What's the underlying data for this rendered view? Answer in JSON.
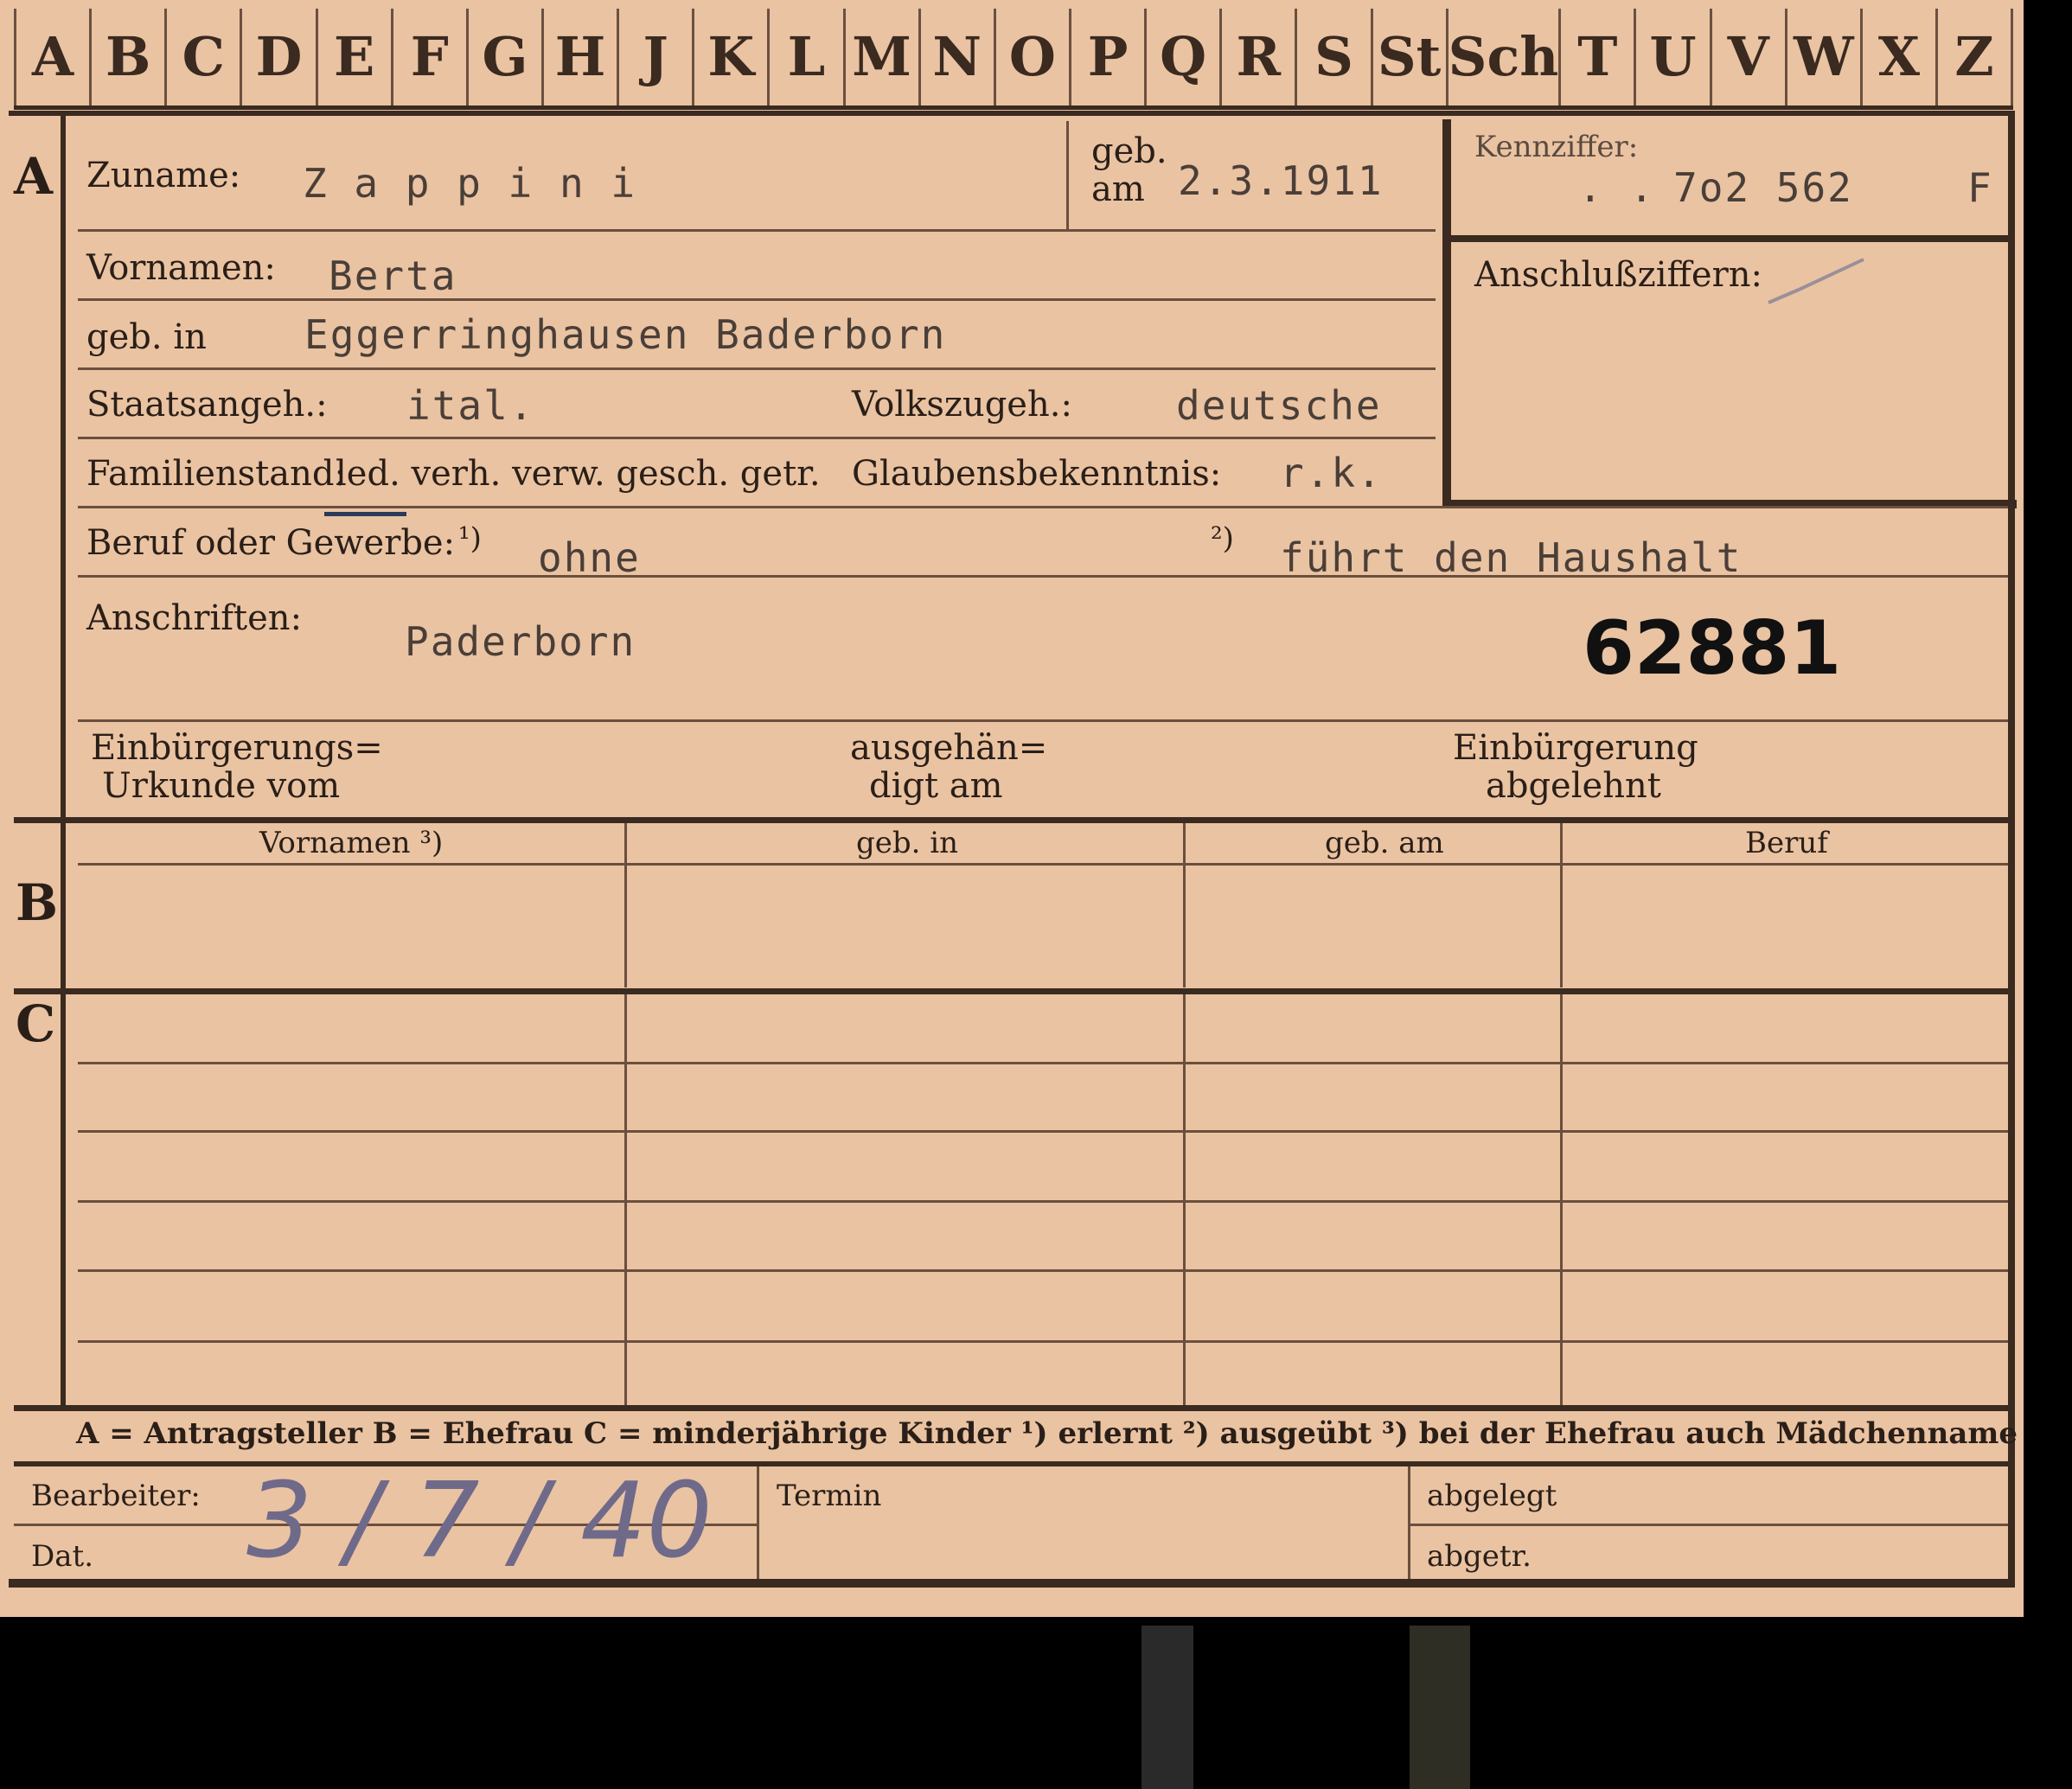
{
  "tabs": [
    "A",
    "B",
    "C",
    "D",
    "E",
    "F",
    "G",
    "H",
    "J",
    "K",
    "L",
    "M",
    "N",
    "O",
    "P",
    "Q",
    "R",
    "S",
    "St",
    "Sch",
    "T",
    "U",
    "V",
    "W",
    "X",
    "Z"
  ],
  "sections": {
    "a": "A",
    "b": "B",
    "c": "C"
  },
  "fields": {
    "zuname_label": "Zuname:",
    "zuname": "Z a p p i n i",
    "geb_am_label_1": "geb.",
    "geb_am_label_2": "am",
    "geb_am": "2.3.1911",
    "kennziffer_label": "Kennziffer:",
    "kennziffer_dots": ". .",
    "kennziffer": "7o2 562",
    "kennziffer_suffix": "F",
    "anschluss_label": "Anschlußziffern:",
    "vornamen_label": "Vornamen:",
    "vornamen": "Berta",
    "geb_in_label": "geb. in",
    "geb_in": "Eggerringhausen  Baderborn",
    "staatsangeh_label": "Staatsangeh.:",
    "staatsangeh": "ital.",
    "volkszugeh_label": "Volkszugeh.:",
    "volkszugeh": "deutsche",
    "familienstand_label": "Familienstand:",
    "familienstand_options": "led.  verh.  verw.  gesch.  getr.",
    "glaubens_label": "Glaubensbekenntnis:",
    "glaubens": "r.k.",
    "beruf_label": "Beruf oder Gewerbe:",
    "beruf_note1": "¹)",
    "beruf_1": "ohne",
    "beruf_note2": "²)",
    "beruf_2": "führt den Haushalt",
    "anschriften_label": "Anschriften:",
    "anschriften": "Paderborn",
    "stamp_number": "62881",
    "einb_urkunde_1": "Einbürgerungs=",
    "einb_urkunde_2": "Urkunde vom",
    "ausgehaend_1": "ausgehän=",
    "ausgehaend_2": "digt am",
    "einb_abgelehnt_1": "Einbürgerung",
    "einb_abgelehnt_2": "abgelehnt"
  },
  "table": {
    "headers": [
      "Vornamen ³)",
      "geb. in",
      "geb. am",
      "Beruf"
    ]
  },
  "legend": "A = Antragsteller    B = Ehefrau    C = minderjährige Kinder    ¹) erlernt    ²) ausgeübt    ³) bei der Ehefrau auch Mädchenname",
  "footer": {
    "bearbeiter_label": "Bearbeiter:",
    "dat_label": "Dat.",
    "date_handwritten": "3 / 7 / 40",
    "termin_label": "Termin",
    "abgelegt_label": "abgelegt",
    "abgetr_label": "abgetr."
  },
  "colors": {
    "card": "#eac3a2",
    "ink": "#2a1f18",
    "typewriter": "#4a3f38",
    "background": "#000000"
  }
}
